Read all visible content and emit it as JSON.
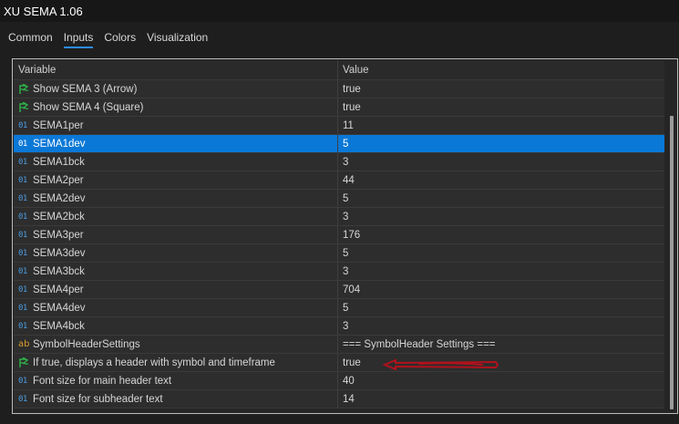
{
  "window": {
    "title": "XU SEMA 1.06"
  },
  "tabs": [
    {
      "label": "Common",
      "active": false
    },
    {
      "label": "Inputs",
      "active": true
    },
    {
      "label": "Colors",
      "active": false
    },
    {
      "label": "Visualization",
      "active": false
    }
  ],
  "table": {
    "headers": {
      "variable": "Variable",
      "value": "Value"
    },
    "rows": [
      {
        "icon": "bool-arrow-icon",
        "variable": "Show SEMA 3 (Arrow)",
        "value": "true"
      },
      {
        "icon": "bool-arrow-icon",
        "variable": "Show SEMA 4 (Square)",
        "value": "true"
      },
      {
        "icon": "int-icon",
        "variable": "SEMA1per",
        "value": "11"
      },
      {
        "icon": "int-icon",
        "variable": "SEMA1dev",
        "value": "5",
        "selected": true
      },
      {
        "icon": "int-icon",
        "variable": "SEMA1bck",
        "value": "3"
      },
      {
        "icon": "int-icon",
        "variable": "SEMA2per",
        "value": "44"
      },
      {
        "icon": "int-icon",
        "variable": "SEMA2dev",
        "value": "5"
      },
      {
        "icon": "int-icon",
        "variable": "SEMA2bck",
        "value": "3"
      },
      {
        "icon": "int-icon",
        "variable": "SEMA3per",
        "value": "176"
      },
      {
        "icon": "int-icon",
        "variable": "SEMA3dev",
        "value": "5"
      },
      {
        "icon": "int-icon",
        "variable": "SEMA3bck",
        "value": "3"
      },
      {
        "icon": "int-icon",
        "variable": "SEMA4per",
        "value": "704"
      },
      {
        "icon": "int-icon",
        "variable": "SEMA4dev",
        "value": "5"
      },
      {
        "icon": "int-icon",
        "variable": "SEMA4bck",
        "value": "3"
      },
      {
        "icon": "string-icon",
        "variable": "SymbolHeaderSettings",
        "value": "=== SymbolHeader Settings ==="
      },
      {
        "icon": "bool-arrow-icon",
        "variable": "If true, displays a header with symbol and timeframe",
        "value": "true"
      },
      {
        "icon": "int-icon",
        "variable": "Font size for main header text",
        "value": "40"
      },
      {
        "icon": "int-icon",
        "variable": "Font size for subheader text",
        "value": "14"
      }
    ]
  },
  "icons": {
    "int_glyph": "01",
    "string_glyph": "ab"
  },
  "colors": {
    "selection": "#0a78d7",
    "int_icon": "#4a9be0",
    "bool_icon": "#2fb44a",
    "string_icon": "#d89a2f",
    "annotation_arrow": "#b0121c"
  }
}
